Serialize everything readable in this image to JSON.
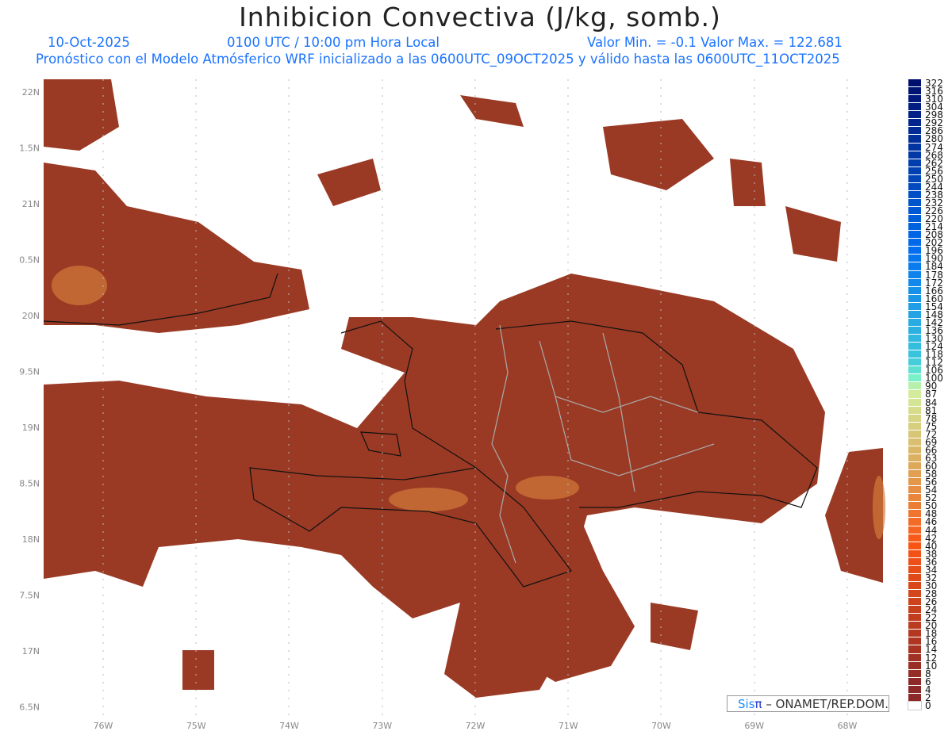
{
  "title": "Inhibicion Convectiva (J/kg, somb.)",
  "header": {
    "date": "10-Oct-2025",
    "time": "0100 UTC / 10:00 pm Hora Local",
    "min_max": "Valor Min. = -0.1  Valor Max. = 122.681",
    "subtitle": "Pronóstico con el Modelo Atmósferico WRF inicializado a las 0600UTC_09OCT2025 y válido hasta las  0600UTC_11OCT2025"
  },
  "map": {
    "lon_labels": [
      "76W",
      "75W",
      "74W",
      "73W",
      "72W",
      "71W",
      "70W",
      "69W",
      "68W"
    ],
    "lat_labels": [
      "22N",
      "1.5N",
      "21N",
      "0.5N",
      "20N",
      "9.5N",
      "19N",
      "8.5N",
      "18N",
      "7.5N",
      "17N",
      "6.5N"
    ],
    "land_color": "#9a3a24"
  },
  "colorbar": {
    "labels": [
      "322",
      "316",
      "310",
      "304",
      "298",
      "292",
      "286",
      "280",
      "274",
      "268",
      "262",
      "256",
      "250",
      "244",
      "238",
      "232",
      "226",
      "220",
      "214",
      "208",
      "202",
      "196",
      "190",
      "184",
      "178",
      "172",
      "166",
      "160",
      "154",
      "148",
      "142",
      "136",
      "130",
      "124",
      "118",
      "112",
      "106",
      "100",
      "90",
      "87",
      "84",
      "81",
      "78",
      "75",
      "72",
      "69",
      "66",
      "63",
      "60",
      "58",
      "56",
      "54",
      "52",
      "50",
      "48",
      "46",
      "44",
      "42",
      "40",
      "38",
      "36",
      "34",
      "32",
      "30",
      "28",
      "26",
      "24",
      "22",
      "20",
      "18",
      "16",
      "14",
      "12",
      "10",
      "8",
      "6",
      "4",
      "2",
      "0"
    ]
  },
  "credit": {
    "brand_a": "Sis",
    "brand_b": "π",
    "text": "– ONAMET/REP.DOM."
  }
}
